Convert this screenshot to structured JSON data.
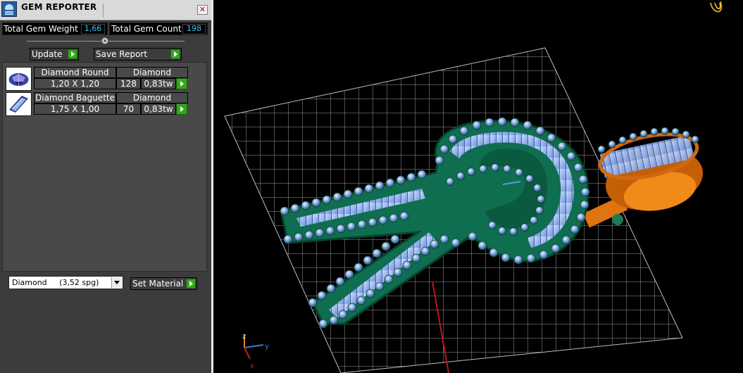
{
  "window": {
    "title": "GEM REPORTER",
    "close_glyph": "✕"
  },
  "totals": {
    "weight_label": "Total Gem Weight",
    "weight_value": "1,66",
    "count_label": "Total Gem Count",
    "count_value": "198"
  },
  "actions": {
    "update_label": "Update",
    "save_report_label": "Save Report"
  },
  "gems": [
    {
      "name": "Diamond Round",
      "material": "Diamond",
      "size": "1,20 X 1,20",
      "count": "128",
      "weight": "0,83tw",
      "icon": "round-gem-icon"
    },
    {
      "name": "Diamond Baguette",
      "material": "Diamond",
      "size": "1,75 X 1,00",
      "count": "70",
      "weight": "0,83tw",
      "icon": "baguette-gem-icon"
    }
  ],
  "material_select": {
    "value": "Diamond     (3,52 spg)"
  },
  "set_material_label": "Set Material",
  "axis": {
    "z": "z",
    "y": "y",
    "x": "x"
  },
  "colors": {
    "accent_green": "#33a81f",
    "value_blue": "#36c7ff",
    "metal_green": "#0f6e4f",
    "bail_orange": "#e07410",
    "stone_blue": "#7fa4e8"
  }
}
